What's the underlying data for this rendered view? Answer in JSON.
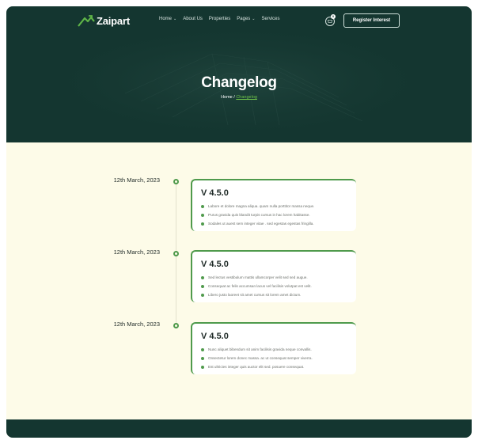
{
  "brand": {
    "name": "Zaipart",
    "accent": "#4f9a4c",
    "dark": "#143630",
    "cream": "#fdfbe8"
  },
  "nav": {
    "items": [
      {
        "label": "Home",
        "dropdown": true
      },
      {
        "label": "About Us",
        "dropdown": false
      },
      {
        "label": "Properties",
        "dropdown": false
      },
      {
        "label": "Pages",
        "dropdown": true
      },
      {
        "label": "Services",
        "dropdown": false
      }
    ],
    "cart_count": "0",
    "cta_label": "Register Interest"
  },
  "hero": {
    "title": "Changelog",
    "breadcrumb": {
      "home": "Home",
      "separator": "/",
      "current": "Changelog"
    }
  },
  "entries": [
    {
      "date": "12th March, 2023",
      "version": "V 4.5.0",
      "items": [
        "Labore et dolore magna aliqua. quam nulla porttitor massa neque.",
        "Purus gravida quis blandit turpis cursus in hac lorem habitasse.",
        "Sodales ut auest sem integer vitae . sed egestas egestas fringilla."
      ]
    },
    {
      "date": "12th March, 2023",
      "version": "V 4.5.0",
      "items": [
        "Sed lectus vestibulum mattis ullamcorper velit sed sed augue.",
        "Consequat ac felis accumsan lacus vel facilisis volutpat est velit.",
        "Libero justo laoreet sit amet cursus sit lorem amet dictum."
      ]
    },
    {
      "date": "12th March, 2023",
      "version": "V 4.5.0",
      "items": [
        "Nunc aliquet bibendum sit anim facilisis gravida neque convallis.",
        "Onsectetur lorem donec massa. ac ut consequat semper viverra.",
        "Est ultricies integer quis auctor elit sed. posuere consequat."
      ]
    }
  ]
}
